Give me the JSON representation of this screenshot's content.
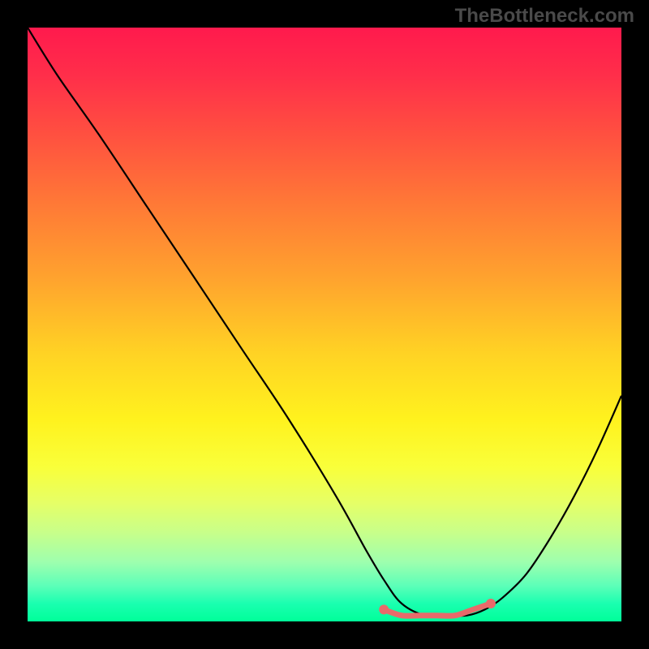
{
  "watermark": "TheBottleneck.com",
  "chart_data": {
    "type": "line",
    "title": "",
    "xlabel": "",
    "ylabel": "",
    "xlim": [
      0,
      100
    ],
    "ylim": [
      0,
      100
    ],
    "series": [
      {
        "name": "bottleneck-curve",
        "x": [
          0,
          5,
          12,
          20,
          28,
          36,
          44,
          52,
          57,
          60,
          63,
          67,
          71,
          74,
          77,
          80,
          84,
          88,
          92,
          96,
          100
        ],
        "values": [
          100,
          92,
          82,
          70,
          58,
          46,
          34,
          21,
          12,
          7,
          3,
          1,
          1,
          1,
          2,
          4,
          8,
          14,
          21,
          29,
          38
        ]
      }
    ],
    "highlight": {
      "name": "optimal-region",
      "x": [
        60,
        63,
        66,
        69,
        72,
        75,
        78
      ],
      "values": [
        2,
        1,
        1,
        1,
        1,
        2,
        3
      ],
      "color": "#e86a6a"
    },
    "gradient_stops": [
      {
        "pos": 0,
        "color": "#ff1a4d"
      },
      {
        "pos": 30,
        "color": "#ff7a36"
      },
      {
        "pos": 55,
        "color": "#ffd324"
      },
      {
        "pos": 74,
        "color": "#f9ff3a"
      },
      {
        "pos": 90,
        "color": "#9effae"
      },
      {
        "pos": 100,
        "color": "#00ff99"
      }
    ]
  }
}
